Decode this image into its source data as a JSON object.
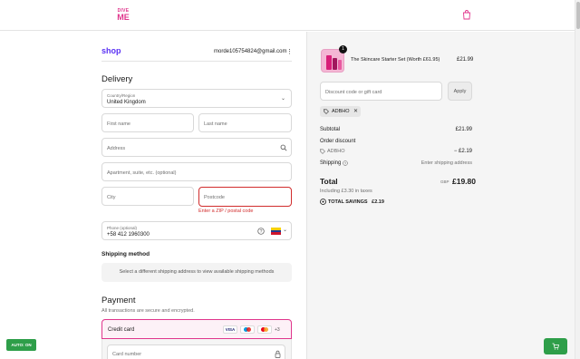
{
  "header": {
    "logo_line1": "DIVE",
    "logo_line2": "ME",
    "cart_icon": "shopping-bag-icon"
  },
  "account": {
    "shop_label": "shop",
    "email": "morde105754824@gmail.com",
    "menu_icon": "more-vertical-icon"
  },
  "delivery": {
    "heading": "Delivery",
    "country_label": "Country/Region",
    "country_value": "United Kingdom",
    "first_name_placeholder": "First name",
    "last_name_placeholder": "Last name",
    "address_placeholder": "Address",
    "apartment_placeholder": "Apartment, suite, etc. (optional)",
    "city_placeholder": "City",
    "postcode_placeholder": "Postcode",
    "postcode_error": "Enter a ZIP / postal code",
    "phone_label": "Phone (optional)",
    "phone_value": "+58 412 1960300",
    "phone_flag": "venezuela-flag"
  },
  "shipping_method": {
    "heading": "Shipping method",
    "message": "Select a different shipping address to view available shipping methods"
  },
  "payment": {
    "heading": "Payment",
    "subtitle": "All transactions are secure and encrypted.",
    "credit_card_label": "Credit card",
    "card_brands": [
      "VISA",
      "maestro",
      "mastercard"
    ],
    "more_brands": "+3",
    "card_number_placeholder": "Card number"
  },
  "auto_badge": "AUTO: ON",
  "summary": {
    "item_qty": "1",
    "item_name": "The Skincare Starter Set (Worth £61.95)",
    "item_price": "£21.99",
    "discount_placeholder": "Discount code or gift card",
    "apply_label": "Apply",
    "applied_code": "ADBHO",
    "subtotal_label": "Subtotal",
    "subtotal_value": "£21.99",
    "order_discount_label": "Order discount",
    "discount_code": "ADBHO",
    "discount_value": "− £2.19",
    "shipping_label": "Shipping",
    "shipping_value": "Enter shipping address",
    "total_label": "Total",
    "total_currency": "GBP",
    "total_value": "£19.80",
    "tax_note": "Including £3.30 in taxes",
    "savings_label": "TOTAL SAVINGS",
    "savings_value": "£2.19"
  },
  "colors": {
    "brand_pink": "#e0358c",
    "shop_purple": "#5a31f4",
    "error_red": "#d12c2c",
    "green": "#2e9e49"
  }
}
